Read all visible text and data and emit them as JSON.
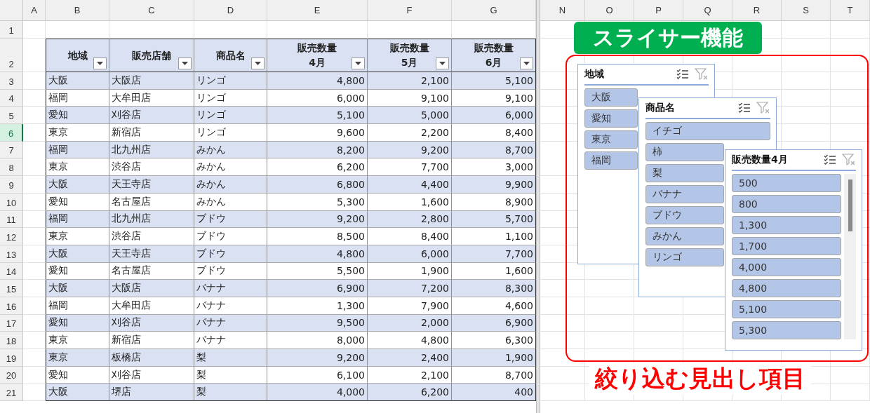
{
  "sheet": {
    "columns": [
      {
        "kind": "column",
        "label": "A"
      },
      {
        "kind": "column",
        "label": "B"
      },
      {
        "kind": "column",
        "label": "C"
      },
      {
        "kind": "column",
        "label": "D"
      },
      {
        "kind": "column",
        "label": "E"
      },
      {
        "kind": "column",
        "label": "F"
      },
      {
        "kind": "column",
        "label": "G"
      },
      {
        "kind": "split"
      },
      {
        "kind": "column",
        "label": "N"
      },
      {
        "kind": "column",
        "label": "O"
      },
      {
        "kind": "column",
        "label": "P"
      },
      {
        "kind": "column",
        "label": "Q"
      },
      {
        "kind": "column",
        "label": "R"
      },
      {
        "kind": "column",
        "label": "S"
      },
      {
        "kind": "column",
        "label": "T"
      }
    ],
    "blank_row": {
      "number": "1",
      "active": false
    },
    "header_row": {
      "number": "2",
      "active": false,
      "cells": [
        {
          "label": "地域"
        },
        {
          "label": "販売店舗"
        },
        {
          "label": "商品名"
        },
        {
          "label": "販売数量",
          "sublabel": "4月"
        },
        {
          "label": "販売数量",
          "sublabel": "5月"
        },
        {
          "label": "販売数量",
          "sublabel": "6月"
        }
      ]
    },
    "rows": [
      {
        "number": "3",
        "active": false,
        "cells": [
          "大阪",
          "大阪店",
          "リンゴ",
          "4,800",
          "2,100",
          "5,100"
        ]
      },
      {
        "number": "4",
        "active": false,
        "cells": [
          "福岡",
          "大牟田店",
          "リンゴ",
          "6,000",
          "9,100",
          "9,100"
        ]
      },
      {
        "number": "5",
        "active": false,
        "cells": [
          "愛知",
          "刈谷店",
          "リンゴ",
          "5,100",
          "5,000",
          "6,000"
        ]
      },
      {
        "number": "6",
        "active": true,
        "cells": [
          "東京",
          "新宿店",
          "リンゴ",
          "9,600",
          "2,200",
          "8,400"
        ]
      },
      {
        "number": "7",
        "active": false,
        "cells": [
          "福岡",
          "北九州店",
          "みかん",
          "8,200",
          "9,200",
          "8,700"
        ]
      },
      {
        "number": "8",
        "active": false,
        "cells": [
          "東京",
          "渋谷店",
          "みかん",
          "6,200",
          "7,700",
          "3,000"
        ]
      },
      {
        "number": "9",
        "active": false,
        "cells": [
          "大阪",
          "天王寺店",
          "みかん",
          "6,800",
          "4,400",
          "9,900"
        ]
      },
      {
        "number": "10",
        "active": false,
        "cells": [
          "愛知",
          "名古屋店",
          "みかん",
          "5,300",
          "1,600",
          "8,900"
        ]
      },
      {
        "number": "11",
        "active": false,
        "cells": [
          "福岡",
          "北九州店",
          "ブドウ",
          "9,200",
          "2,800",
          "5,700"
        ]
      },
      {
        "number": "12",
        "active": false,
        "cells": [
          "東京",
          "渋谷店",
          "ブドウ",
          "8,500",
          "8,400",
          "1,100"
        ]
      },
      {
        "number": "13",
        "active": false,
        "cells": [
          "大阪",
          "天王寺店",
          "ブドウ",
          "4,800",
          "6,000",
          "7,700"
        ]
      },
      {
        "number": "14",
        "active": false,
        "cells": [
          "愛知",
          "名古屋店",
          "ブドウ",
          "5,500",
          "1,900",
          "1,600"
        ]
      },
      {
        "number": "15",
        "active": false,
        "cells": [
          "大阪",
          "大阪店",
          "バナナ",
          "6,900",
          "7,200",
          "8,300"
        ]
      },
      {
        "number": "16",
        "active": false,
        "cells": [
          "福岡",
          "大牟田店",
          "バナナ",
          "1,300",
          "7,900",
          "4,600"
        ]
      },
      {
        "number": "17",
        "active": false,
        "cells": [
          "愛知",
          "刈谷店",
          "バナナ",
          "9,500",
          "2,000",
          "6,900"
        ]
      },
      {
        "number": "18",
        "active": false,
        "cells": [
          "東京",
          "新宿店",
          "バナナ",
          "8,000",
          "4,800",
          "6,300"
        ]
      },
      {
        "number": "19",
        "active": false,
        "cells": [
          "東京",
          "板橋店",
          "梨",
          "9,200",
          "2,400",
          "1,900"
        ]
      },
      {
        "number": "20",
        "active": false,
        "cells": [
          "愛知",
          "刈谷店",
          "梨",
          "6,100",
          "2,100",
          "8,700"
        ]
      },
      {
        "number": "21",
        "active": false,
        "cells": [
          "大阪",
          "堺店",
          "梨",
          "4,000",
          "6,200",
          "400"
        ]
      }
    ]
  },
  "slicers": [
    {
      "title": "地域",
      "scrollbar": false,
      "items": [
        {
          "label": "大阪",
          "selected": true
        },
        {
          "label": "愛知",
          "selected": true
        },
        {
          "label": "東京",
          "selected": true
        },
        {
          "label": "福岡",
          "selected": true
        }
      ]
    },
    {
      "title": "商品名",
      "scrollbar": false,
      "items": [
        {
          "label": "イチゴ",
          "selected": true
        },
        {
          "label": "柿",
          "selected": true
        },
        {
          "label": "梨",
          "selected": true
        },
        {
          "label": "バナナ",
          "selected": true
        },
        {
          "label": "ブドウ",
          "selected": true
        },
        {
          "label": "みかん",
          "selected": true
        },
        {
          "label": "リンゴ",
          "selected": true
        }
      ]
    },
    {
      "title": "販売数量4月",
      "scrollbar": true,
      "items": [
        {
          "label": "500",
          "selected": true
        },
        {
          "label": "800",
          "selected": true
        },
        {
          "label": "1,300",
          "selected": true
        },
        {
          "label": "1,700",
          "selected": true
        },
        {
          "label": "4,000",
          "selected": true
        },
        {
          "label": "4,800",
          "selected": true
        },
        {
          "label": "5,100",
          "selected": true
        },
        {
          "label": "5,300",
          "selected": true
        }
      ]
    }
  ],
  "callout_title": "スライサー機能",
  "callout_caption": "絞り込む見出し項目"
}
